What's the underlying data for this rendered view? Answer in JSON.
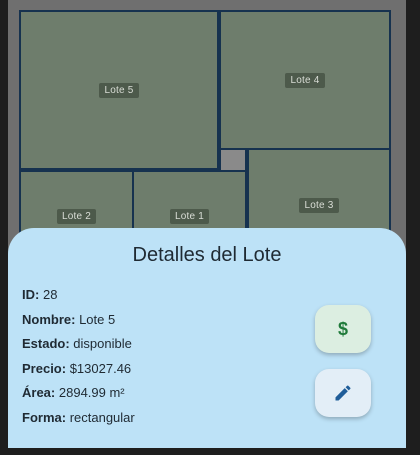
{
  "map": {
    "lots": [
      {
        "label": "Lote 5"
      },
      {
        "label": "Lote 4"
      },
      {
        "label": "Lote 2"
      },
      {
        "label": "Lote 1"
      },
      {
        "label": "Lote 3"
      }
    ]
  },
  "details": {
    "title": "Detalles del Lote",
    "rows": [
      {
        "key": "ID:",
        "value": "28"
      },
      {
        "key": "Nombre:",
        "value": "Lote 5"
      },
      {
        "key": "Estado:",
        "value": "disponible"
      },
      {
        "key": "Precio:",
        "value": "$13027.46"
      },
      {
        "key": "Área:",
        "value": "2894.99 m²"
      },
      {
        "key": "Forma:",
        "value": "rectangular"
      }
    ]
  },
  "actions": {
    "price_icon": "dollar-icon",
    "edit_icon": "pencil-icon",
    "price_glyph": "$"
  },
  "colors": {
    "lot_fill": "#6e7d6c",
    "lot_border": "#16324f",
    "sheet_bg": "#bde2f7",
    "price_accent": "#1f7a3a",
    "edit_accent": "#1f5d99"
  }
}
